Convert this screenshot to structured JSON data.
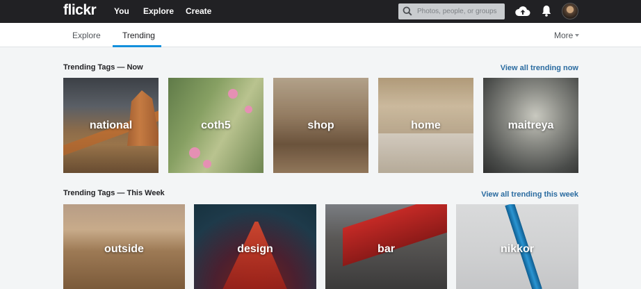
{
  "header": {
    "logo": "flickr",
    "nav": [
      "You",
      "Explore",
      "Create"
    ],
    "search_placeholder": "Photos, people, or groups",
    "icons": [
      "search-icon",
      "cloud-upload-icon",
      "bell-icon",
      "avatar"
    ]
  },
  "subnav": {
    "tabs": [
      "Explore",
      "Trending"
    ],
    "active_tab": "Trending",
    "more_label": "More"
  },
  "sections": [
    {
      "title": "Trending Tags — Now",
      "view_all": "View all trending now",
      "tags": [
        "national",
        "coth5",
        "shop",
        "home",
        "maitreya"
      ]
    },
    {
      "title": "Trending Tags — This Week",
      "view_all": "View all trending this week",
      "tags": [
        "outside",
        "design",
        "bar",
        "nikkor"
      ]
    }
  ],
  "colors": {
    "topbar": "#212124",
    "accent": "#128fdc",
    "link": "#2a6ba0",
    "background": "#f3f5f6"
  }
}
